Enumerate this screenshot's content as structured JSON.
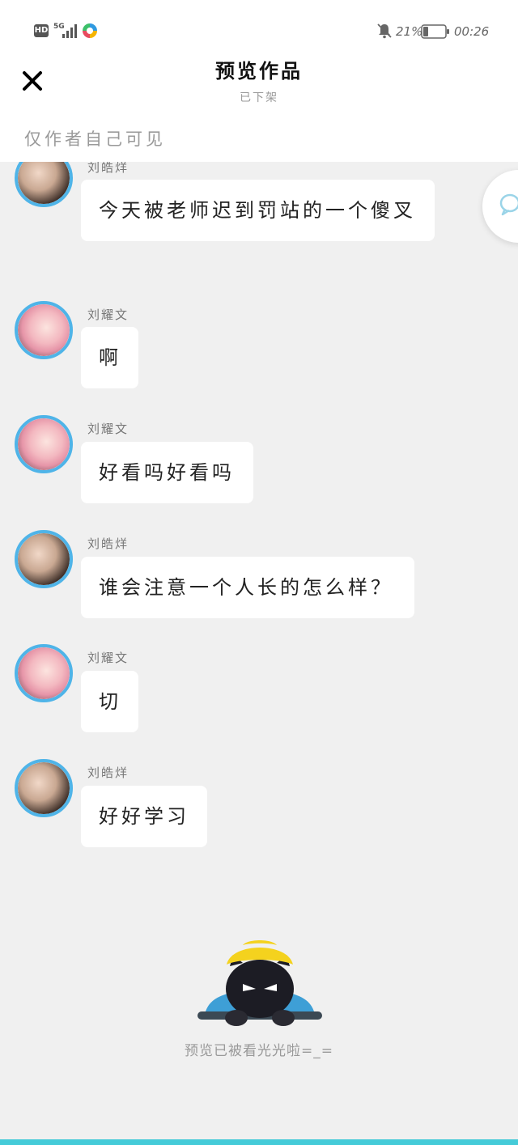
{
  "status_bar": {
    "hd": "HD",
    "network": "5G",
    "battery_percent": "21%",
    "time": "00:26",
    "icons": [
      "signal-icon",
      "app-badge-icon",
      "bell-off-icon",
      "battery-icon"
    ]
  },
  "header": {
    "close_icon": "close-icon",
    "title": "预览作品",
    "subtitle": "已下架",
    "visibility_note": "仅作者自己可见"
  },
  "messages": [
    {
      "sender": "刘皓烊",
      "text": "今天被老师迟到罚站的一个傻叉"
    },
    {
      "sender": "刘耀文",
      "text": "啊"
    },
    {
      "sender": "刘耀文",
      "text": "好看吗好看吗"
    },
    {
      "sender": "刘皓烊",
      "text": "谁会注意一个人长的怎么样？"
    },
    {
      "sender": "刘耀文",
      "text": "切"
    },
    {
      "sender": "刘皓烊",
      "text": "好好学习"
    }
  ],
  "footer": {
    "end_text": "预览已被看光光啦=_=",
    "mascot_icon": "mascot-icon"
  },
  "colors": {
    "accent": "#4fb4e8",
    "background": "#f0f0f0",
    "bubble": "#ffffff",
    "bottom_bar": "#45cbd8"
  }
}
